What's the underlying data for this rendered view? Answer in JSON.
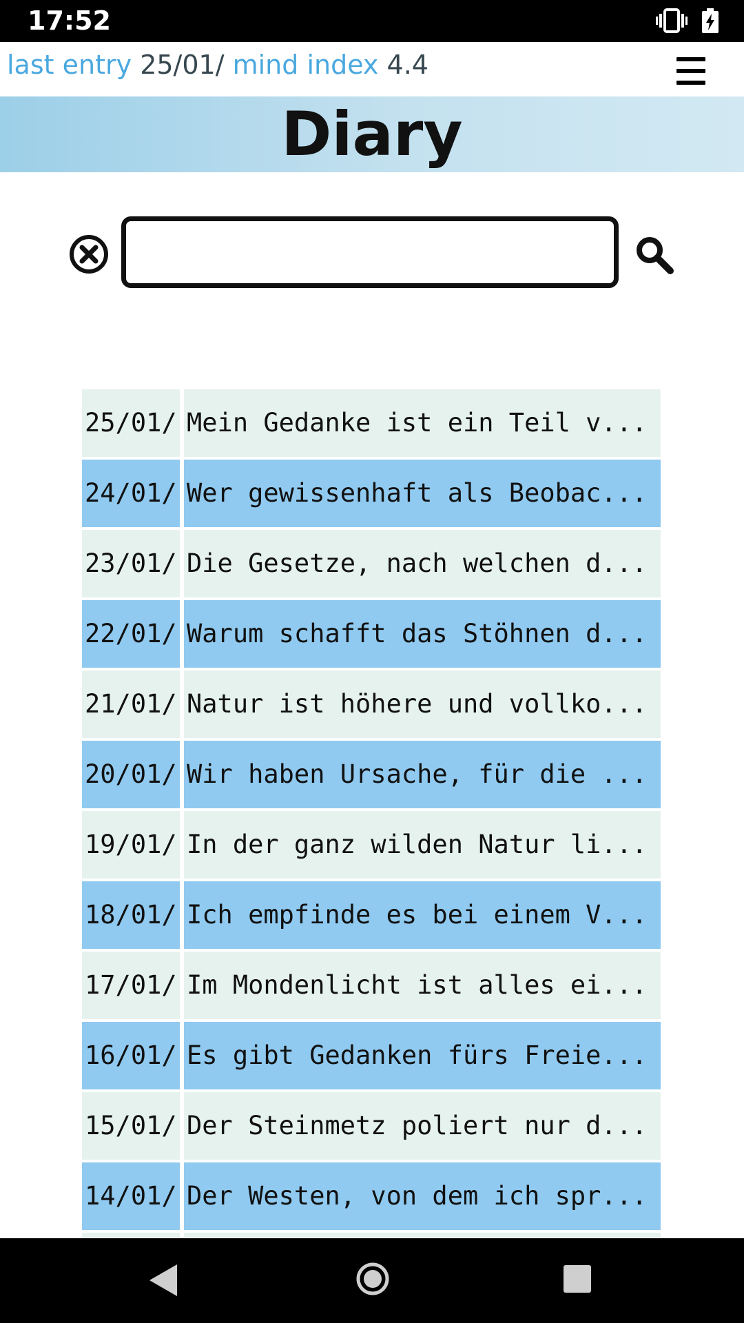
{
  "status_bar": {
    "time": "17:52",
    "icons": [
      "vibrate-icon",
      "battery-charging-icon"
    ]
  },
  "info_bar": {
    "last_entry_label": "last entry",
    "last_entry_value": "25/01/",
    "mind_index_label": "mind index",
    "mind_index_value": "4.4",
    "menu_icon": "hamburger-menu-icon"
  },
  "title": "Diary",
  "search": {
    "value": "",
    "placeholder": "",
    "clear_icon": "close-circle-icon",
    "search_icon": "magnifier-icon"
  },
  "entries": [
    {
      "date": "25/01/",
      "text": "Mein Gedanke ist ein Teil v..."
    },
    {
      "date": "24/01/",
      "text": "Wer gewissenhaft als Beobac..."
    },
    {
      "date": "23/01/",
      "text": "Die Gesetze, nach welchen d..."
    },
    {
      "date": "22/01/",
      "text": "Warum schafft das Stöhnen d..."
    },
    {
      "date": "21/01/",
      "text": "Natur ist höhere und vollko..."
    },
    {
      "date": "20/01/",
      "text": "Wir haben Ursache, für die ..."
    },
    {
      "date": "19/01/",
      "text": "In der ganz wilden Natur li..."
    },
    {
      "date": "18/01/",
      "text": "Ich empfinde es bei einem V..."
    },
    {
      "date": "17/01/",
      "text": "Im Mondenlicht ist alles ei..."
    },
    {
      "date": "16/01/",
      "text": "Es gibt Gedanken fürs Freie..."
    },
    {
      "date": "15/01/",
      "text": "Der Steinmetz poliert nur d..."
    },
    {
      "date": "14/01/",
      "text": "Der Westen, von dem ich spr..."
    }
  ],
  "colors": {
    "accent_label": "#4aa8df",
    "row_light": "#e6f2ee",
    "row_blue": "#90caf0",
    "banner": "#c4e1ef"
  },
  "nav_bar": {
    "icons": [
      "back-triangle-icon",
      "home-circle-icon",
      "recents-square-icon"
    ]
  }
}
